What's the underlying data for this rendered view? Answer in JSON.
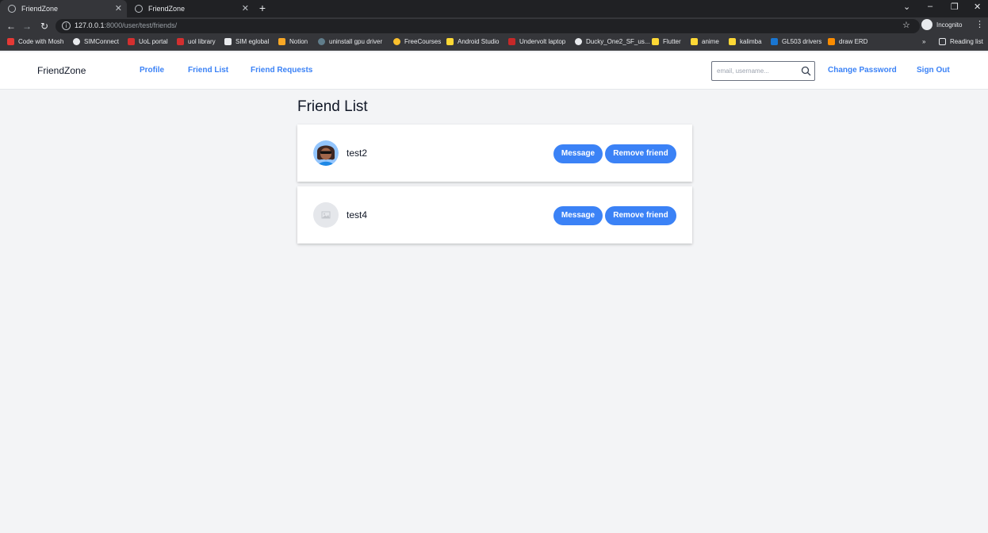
{
  "browser": {
    "tabs": [
      {
        "title": "FriendZone",
        "active": true
      },
      {
        "title": "FriendZone",
        "active": false
      }
    ],
    "new_tab": "+",
    "url_host": "127.0.0.1",
    "url_rest": ":8000/user/test/friends/",
    "profile_label": "Incognito",
    "bookmarks": [
      {
        "label": "Code with Mosh",
        "color": "#e53935"
      },
      {
        "label": "SIMConnect",
        "color": "#e8eaed"
      },
      {
        "label": "UoL portal",
        "color": "#d32f2f"
      },
      {
        "label": "uol library",
        "color": "#d32f2f"
      },
      {
        "label": "SIM eglobal",
        "color": "#e8eaed"
      },
      {
        "label": "Notion",
        "color": "#f9a825"
      },
      {
        "label": "uninstall gpu driver",
        "color": "#607d8b"
      },
      {
        "label": "FreeCourses",
        "color": "#fbc02d"
      },
      {
        "label": "Android Studio",
        "color": "#fdd835"
      },
      {
        "label": "Undervolt laptop",
        "color": "#c62828"
      },
      {
        "label": "Ducky_One2_SF_us...",
        "color": "#e8eaed"
      },
      {
        "label": "Flutter",
        "color": "#fdd835"
      },
      {
        "label": "anime",
        "color": "#fdd835"
      },
      {
        "label": "kalimba",
        "color": "#fdd835"
      },
      {
        "label": "GL503 drivers",
        "color": "#1976d2"
      },
      {
        "label": "draw ERD",
        "color": "#fb8c00"
      }
    ],
    "more_bookmarks": "»",
    "reading_list": "Reading list"
  },
  "app": {
    "brand": "FriendZone",
    "nav": {
      "profile": "Profile",
      "friend_list": "Friend List",
      "friend_requests": "Friend Requests"
    },
    "search_placeholder": "email, username...",
    "change_password": "Change Password",
    "sign_out": "Sign Out"
  },
  "page": {
    "title": "Friend List",
    "friends": [
      {
        "username": "test2",
        "avatar": "photo",
        "message_label": "Message",
        "remove_label": "Remove friend"
      },
      {
        "username": "test4",
        "avatar": "placeholder",
        "message_label": "Message",
        "remove_label": "Remove friend"
      }
    ]
  },
  "colors": {
    "accent": "#3b82f6",
    "background": "#f3f4f6",
    "chrome_dark": "#202124",
    "chrome_toolbar": "#35363a"
  }
}
